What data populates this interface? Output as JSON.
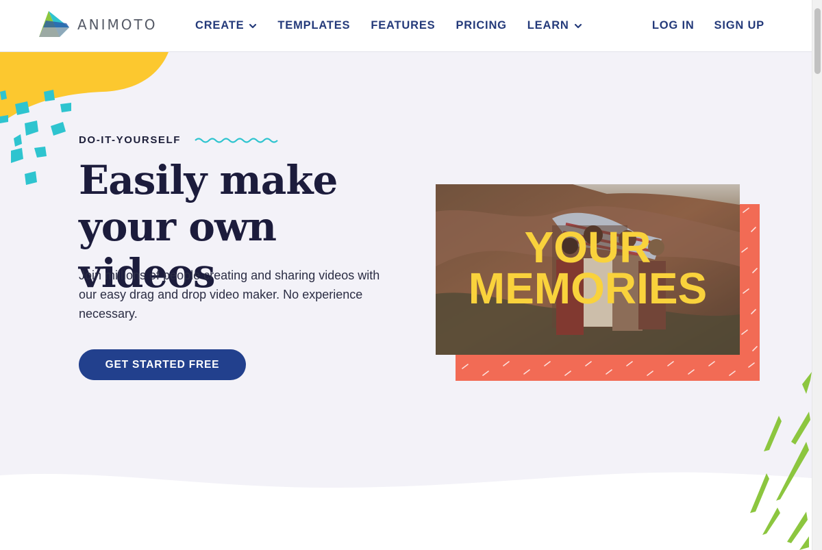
{
  "header": {
    "logo_text": "ANIMOTO",
    "nav": [
      {
        "label": "CREATE",
        "has_dropdown": true
      },
      {
        "label": "TEMPLATES",
        "has_dropdown": false
      },
      {
        "label": "FEATURES",
        "has_dropdown": false
      },
      {
        "label": "PRICING",
        "has_dropdown": false
      },
      {
        "label": "LEARN",
        "has_dropdown": true
      }
    ],
    "login_label": "LOG IN",
    "signup_label": "SIGN UP"
  },
  "hero": {
    "eyebrow": "DO-IT-YOURSELF",
    "headline": "Easily make your own videos",
    "subcopy": "Join millions of people creating and sharing videos with our easy drag and drop video maker. No experience necessary.",
    "cta_label": "GET STARTED FREE",
    "video_overlay_line1": "YOUR",
    "video_overlay_line2": "MEMORIES"
  },
  "colors": {
    "brand_navy": "#22408d",
    "nav_text": "#243a7a",
    "hero_bg": "#f3f2f8",
    "accent_yellow": "#fcc82f",
    "accent_teal": "#2ec4cf",
    "accent_coral": "#f26b55",
    "accent_green": "#8cc63f",
    "overlay_yellow": "#f9d23c"
  },
  "icons": {
    "logo": "animoto-triangle-logo-icon",
    "dropdown": "chevron-down-icon",
    "squiggle": "wave-squiggle-icon"
  }
}
